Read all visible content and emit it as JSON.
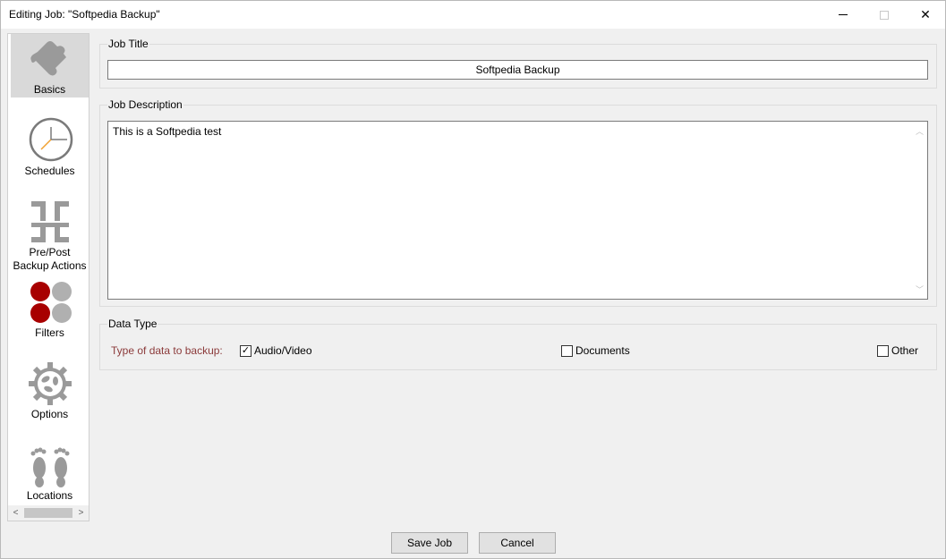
{
  "window": {
    "title": "Editing Job: \"Softpedia Backup\"",
    "close_glyph": "✕"
  },
  "sidebar": {
    "items": [
      {
        "label": "Basics",
        "icon": "puzzle-icon",
        "active": true
      },
      {
        "label": "Schedules",
        "icon": "clock-icon"
      },
      {
        "label": "Pre/Post Backup Actions",
        "icon": "actions-icon"
      },
      {
        "label": "Filters",
        "icon": "filters-icon"
      },
      {
        "label": "Options",
        "icon": "gear-icon"
      },
      {
        "label": "Locations",
        "icon": "footprints-icon"
      }
    ],
    "scroll_left": "<",
    "scroll_right": ">"
  },
  "job_title": {
    "group_label": "Job Title",
    "value": "Softpedia Backup"
  },
  "job_description": {
    "group_label": "Job Description",
    "value": "This is a Softpedia test",
    "scroll_up": "︿",
    "scroll_down": "﹀"
  },
  "data_type": {
    "group_label": "Data Type",
    "prompt": "Type of data to backup:",
    "options": [
      {
        "label": "Audio/Video",
        "checked": true,
        "mark": "✓"
      },
      {
        "label": "Documents",
        "checked": false
      },
      {
        "label": "Other",
        "checked": false
      }
    ]
  },
  "buttons": {
    "save": "Save Job",
    "cancel": "Cancel"
  },
  "colors": {
    "filters_red": "#a80000",
    "filters_gray": "#b0b0b0",
    "prompt_text": "#8b3a3a",
    "active_nav": "#d9d9d9"
  }
}
